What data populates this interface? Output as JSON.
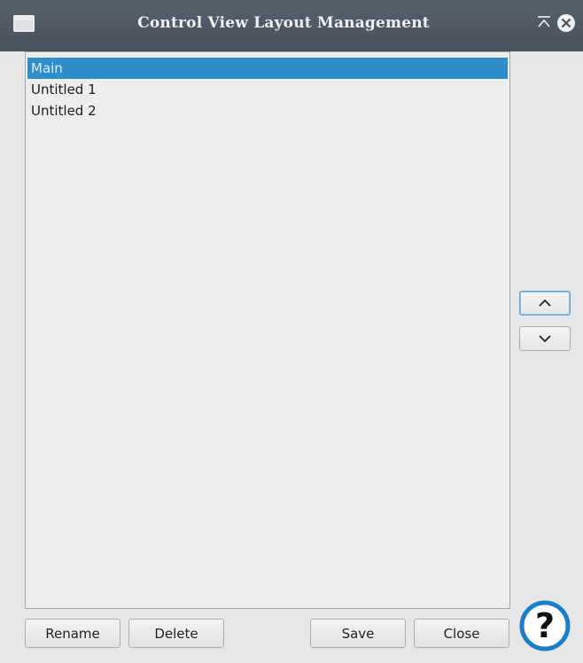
{
  "window": {
    "title": "Control View Layout Management"
  },
  "layouts": {
    "items": [
      {
        "label": "Main",
        "selected": true
      },
      {
        "label": "Untitled 1",
        "selected": false
      },
      {
        "label": "Untitled 2",
        "selected": false
      }
    ]
  },
  "buttons": {
    "rename": "Rename",
    "delete": "Delete",
    "save": "Save",
    "close": "Close"
  },
  "icons": {
    "app": "window-icon",
    "minimize": "minimize-icon",
    "close": "close-icon",
    "move_up": "chevron-up-icon",
    "move_down": "chevron-down-icon",
    "help": "help-icon"
  },
  "colors": {
    "titlebar": "#4f5863",
    "selection": "#2f8dc8",
    "help": "#1a7fc6"
  }
}
